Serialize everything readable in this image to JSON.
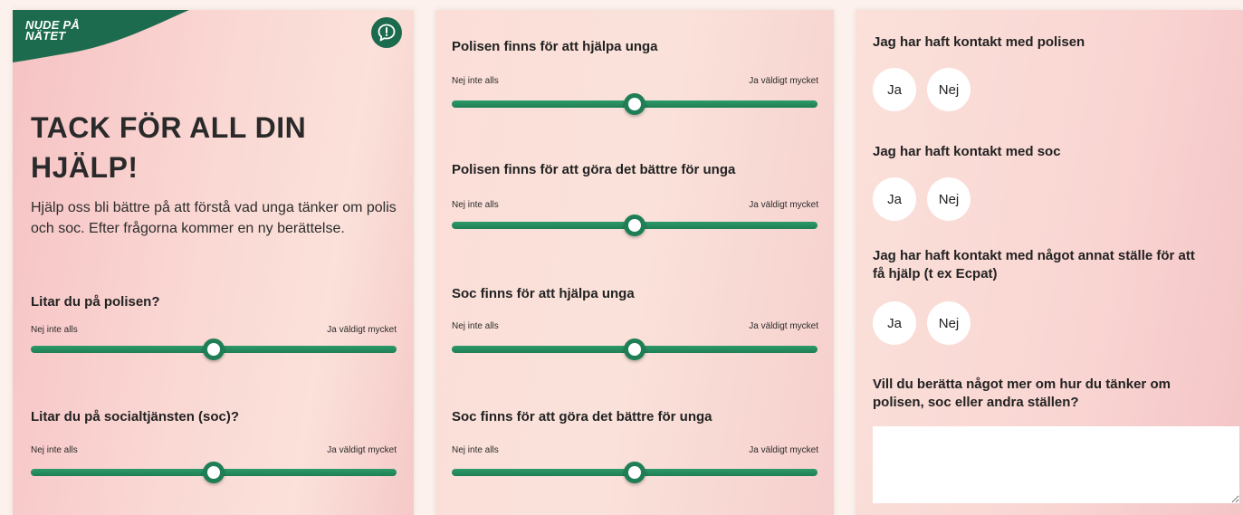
{
  "brand": {
    "logo_line1": "NUDE PÅ",
    "logo_line2": "NÄTET",
    "green": "#1f7e55",
    "dark_green": "#1c6b4e"
  },
  "icons": {
    "chat": "chat-bubble-exclamation-icon"
  },
  "panel1": {
    "title": "TACK FÖR ALL DIN HJÄLP!",
    "intro": "Hjälp oss bli bättre på att förstå vad unga tänker om polis och soc. Efter frågorna kommer en ny berättelse.",
    "questions": [
      {
        "label": "Litar du på polisen?",
        "min_label": "Nej inte alls",
        "max_label": "Ja väldigt mycket",
        "value": 0.5
      },
      {
        "label": "Litar du på socialtjänsten (soc)?",
        "min_label": "Nej inte alls",
        "max_label": "Ja väldigt mycket",
        "value": 0.5
      }
    ]
  },
  "panel2": {
    "questions": [
      {
        "label": "Polisen finns för att hjälpa unga",
        "min_label": "Nej inte alls",
        "max_label": "Ja väldigt mycket",
        "value": 0.5
      },
      {
        "label": "Polisen finns för att göra det bättre för unga",
        "min_label": "Nej inte alls",
        "max_label": "Ja väldigt mycket",
        "value": 0.5
      },
      {
        "label": "Soc finns för att hjälpa unga",
        "min_label": "Nej inte alls",
        "max_label": "Ja väldigt mycket",
        "value": 0.5
      },
      {
        "label": "Soc finns för att göra det bättre för unga",
        "min_label": "Nej inte alls",
        "max_label": "Ja väldigt mycket",
        "value": 0.5
      }
    ]
  },
  "panel3": {
    "yes_label": "Ja",
    "no_label": "Nej",
    "questions": [
      {
        "label": "Jag har haft kontakt med polisen"
      },
      {
        "label": "Jag har haft kontakt med soc"
      },
      {
        "label_line1": "Jag har haft kontakt med något annat ställe för att",
        "label_line2": "få hjälp (t ex Ecpat)"
      }
    ],
    "open_question_line1": "Vill du berätta något mer om hur du tänker om",
    "open_question_line2": "polisen, soc eller andra ställen?",
    "textarea_value": ""
  }
}
